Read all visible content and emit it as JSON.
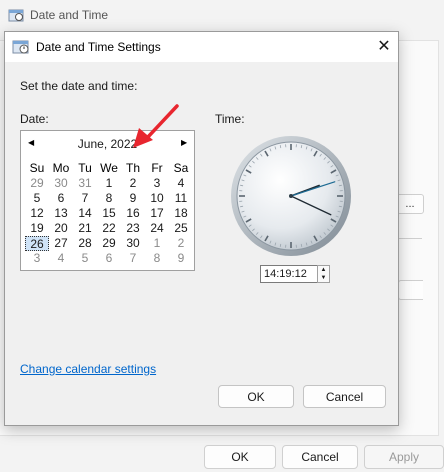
{
  "background_window": {
    "title": "Date and Time",
    "ellipsis_label": "...",
    "buttons": {
      "ok": "OK",
      "cancel": "Cancel",
      "apply": "Apply"
    }
  },
  "dialog": {
    "title": "Date and Time Settings",
    "close_glyph": "✕",
    "heading": "Set the date and time:",
    "date_label": "Date:",
    "time_label": "Time:",
    "calendar": {
      "month_label": "June, 2022",
      "prev_glyph": "◀",
      "next_glyph": "▶",
      "weekdays": [
        "Su",
        "Mo",
        "Tu",
        "We",
        "Th",
        "Fr",
        "Sa"
      ],
      "weeks": [
        [
          "29",
          "30",
          "31",
          "1",
          "2",
          "3",
          "4"
        ],
        [
          "5",
          "6",
          "7",
          "8",
          "9",
          "10",
          "11"
        ],
        [
          "12",
          "13",
          "14",
          "15",
          "16",
          "17",
          "18"
        ],
        [
          "19",
          "20",
          "21",
          "22",
          "23",
          "24",
          "25"
        ],
        [
          "26",
          "27",
          "28",
          "29",
          "30",
          "1",
          "2"
        ],
        [
          "3",
          "4",
          "5",
          "6",
          "7",
          "8",
          "9"
        ]
      ],
      "dim_cells": [
        [
          0,
          0
        ],
        [
          0,
          1
        ],
        [
          0,
          2
        ],
        [
          4,
          5
        ],
        [
          4,
          6
        ],
        [
          5,
          0
        ],
        [
          5,
          1
        ],
        [
          5,
          2
        ],
        [
          5,
          3
        ],
        [
          5,
          4
        ],
        [
          5,
          5
        ],
        [
          5,
          6
        ]
      ],
      "selected_cell": [
        4,
        0
      ]
    },
    "clock": {
      "hour": 14,
      "minute": 19,
      "second": 12
    },
    "time_value": "14:19:12",
    "spin_up_glyph": "▲",
    "spin_down_glyph": "▼",
    "change_calendar_link": "Change calendar settings",
    "ok_label": "OK",
    "cancel_label": "Cancel"
  },
  "colors": {
    "annotation_arrow": "#e8262f",
    "link": "#0066cc",
    "selection": "#cfe3f7"
  }
}
